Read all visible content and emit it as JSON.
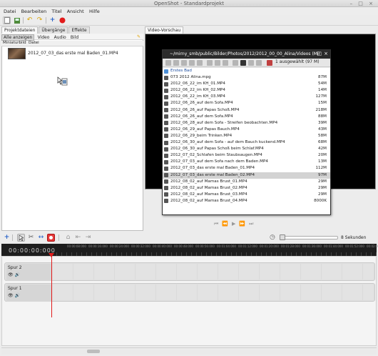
{
  "window": {
    "title": "OpenShot - Standardprojekt",
    "buttons": "– □ ×"
  },
  "menu": [
    {
      "label": "Datei"
    },
    {
      "label": "Bearbeiten"
    },
    {
      "label": "Titel"
    },
    {
      "label": "Ansicht"
    },
    {
      "label": "Hilfe"
    }
  ],
  "left_tabs": [
    {
      "label": "Projektdateien"
    },
    {
      "label": "Übergänge"
    },
    {
      "label": "Effekte"
    }
  ],
  "filters": [
    {
      "label": "Alle anzeigen"
    },
    {
      "label": "Video"
    },
    {
      "label": "Audio"
    },
    {
      "label": "Bild"
    }
  ],
  "columns": {
    "thumb": "Miniaturbild",
    "file": "Datei"
  },
  "project_files": [
    {
      "name": "2012_07_03_das erste mal Baden_01.MP4"
    }
  ],
  "preview_tab": "Video-Vorschau",
  "file_dialog": {
    "title": "~/mirny_smb/public/Bilder/Photos/2012/2012_00_00_Alina/Videos (Mir",
    "selection_info": "1 ausgewählt (97 M)",
    "rows": [
      {
        "name": "Erstes Bad",
        "size": "",
        "folder": true
      },
      {
        "name": "073 2012 Alina.mpg",
        "size": "87M"
      },
      {
        "name": "2012_06_22_im KH_01.MP4",
        "size": "54M"
      },
      {
        "name": "2012_06_22_im KH_02.MP4",
        "size": "14M"
      },
      {
        "name": "2012_06_22_im KH_03.MP4",
        "size": "127M"
      },
      {
        "name": "2012_06_26_auf dem Sofa.MP4",
        "size": "15M"
      },
      {
        "name": "2012_06_26_auf Papas Schoß.MP4",
        "size": "218M"
      },
      {
        "name": "2012_06_26_auf dem Sofa.MP4",
        "size": "88M"
      },
      {
        "name": "2012_06_28_auf dem Sofa - Streifen beobachten.MP4",
        "size": "39M"
      },
      {
        "name": "2012_06_29_auf Papas Bauch.MP4",
        "size": "43M"
      },
      {
        "name": "2012_06_29_beim Trinken.MP4",
        "size": "58M"
      },
      {
        "name": "2012_06_30_auf dem Sofa - auf dem Bauch kuckend.MP4",
        "size": "68M"
      },
      {
        "name": "2012_06_30_auf Papas Schoß beim Schlaf.MP4",
        "size": "42M"
      },
      {
        "name": "2012_07_02_Schlafen beim Staubsaugen.MP4",
        "size": "20M"
      },
      {
        "name": "2012_07_03_auf dem Sofa nach dem Baden.MP4",
        "size": "13M"
      },
      {
        "name": "2012_07_03_das erste mal Baden_01.MP4",
        "size": "112M"
      },
      {
        "name": "2012_07_03_das erste mal Baden_02.MP4",
        "size": "97M",
        "selected": true
      },
      {
        "name": "2012_08_02_auf Mamas Brust_01.MP4",
        "size": "29M"
      },
      {
        "name": "2012_08_02_auf Mamas Brust_02.MP4",
        "size": "29M"
      },
      {
        "name": "2012_08_02_auf Mamas Brust_03.MP4",
        "size": "29M"
      },
      {
        "name": "2012_08_02_auf Mamas Brust_04.MP4",
        "size": "8000K"
      }
    ]
  },
  "timeline": {
    "timecode": "00:00:00:000",
    "zoom_label": "8 Sekunden",
    "ticks": [
      "00:00:08:000",
      "00:00:16:000",
      "00:00:24:000",
      "00:00:32:000",
      "00:00:40:000",
      "00:00:48:000",
      "00:00:56:000",
      "00:01:04:000",
      "00:01:12:000",
      "00:01:20:000",
      "00:01:28:000",
      "00:01:36:000",
      "00:01:44:000",
      "00:01:52:000",
      "00:02:00:000"
    ],
    "tracks": [
      {
        "name": "Spur 2"
      },
      {
        "name": "Spur 1"
      }
    ]
  }
}
